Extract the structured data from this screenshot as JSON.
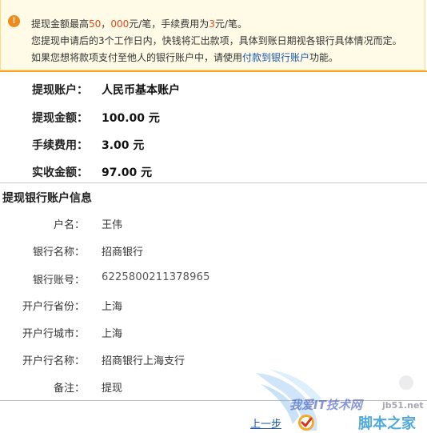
{
  "notice": {
    "line1_a": "提现金额最高",
    "line1_num1": "50",
    "line1_b": "，",
    "line1_num2": "000",
    "line1_c": "元/笔，手续费用为",
    "line1_num3": "3",
    "line1_d": "元/笔。",
    "line2": "您提现申请后的3个工作日内，快钱将汇出款项，具体到账日期视各银行具体情况而定。",
    "line3_a": "如果您想将款项支付至他人的银行账户中，请使用",
    "line3_link": "付款到银行账户",
    "line3_b": "功能。"
  },
  "summary": [
    {
      "label": "提现账户：",
      "value": "人民币基本账户"
    },
    {
      "label": "提现金额：",
      "value": "100.00 元"
    },
    {
      "label": "手续费用：",
      "value": "3.00 元"
    },
    {
      "label": "实收金额：",
      "value": "97.00 元"
    }
  ],
  "bank_section": {
    "title": "提现银行账户信息",
    "rows": [
      {
        "label": "户名：",
        "value": "王伟"
      },
      {
        "label": "银行名称：",
        "value": "招商银行"
      },
      {
        "label": "银行账号：",
        "value": "6225800211378965"
      },
      {
        "label": "开户行省份：",
        "value": "上海"
      },
      {
        "label": "开户行城市：",
        "value": "上海"
      },
      {
        "label": "开户行名称：",
        "value": "招商银行上海支行"
      },
      {
        "label": "备注：",
        "value": "提现"
      }
    ]
  },
  "actions": {
    "prev": "上一步"
  },
  "watermark": {
    "brand": "我爱IT技术网",
    "url": "jb51.net",
    "site": "脚本之家"
  },
  "colors": {
    "notice_bg": "#fffbe6",
    "accent_orange": "#f7a82c",
    "link_blue": "#1a55b0",
    "number_red": "#e2481e"
  }
}
